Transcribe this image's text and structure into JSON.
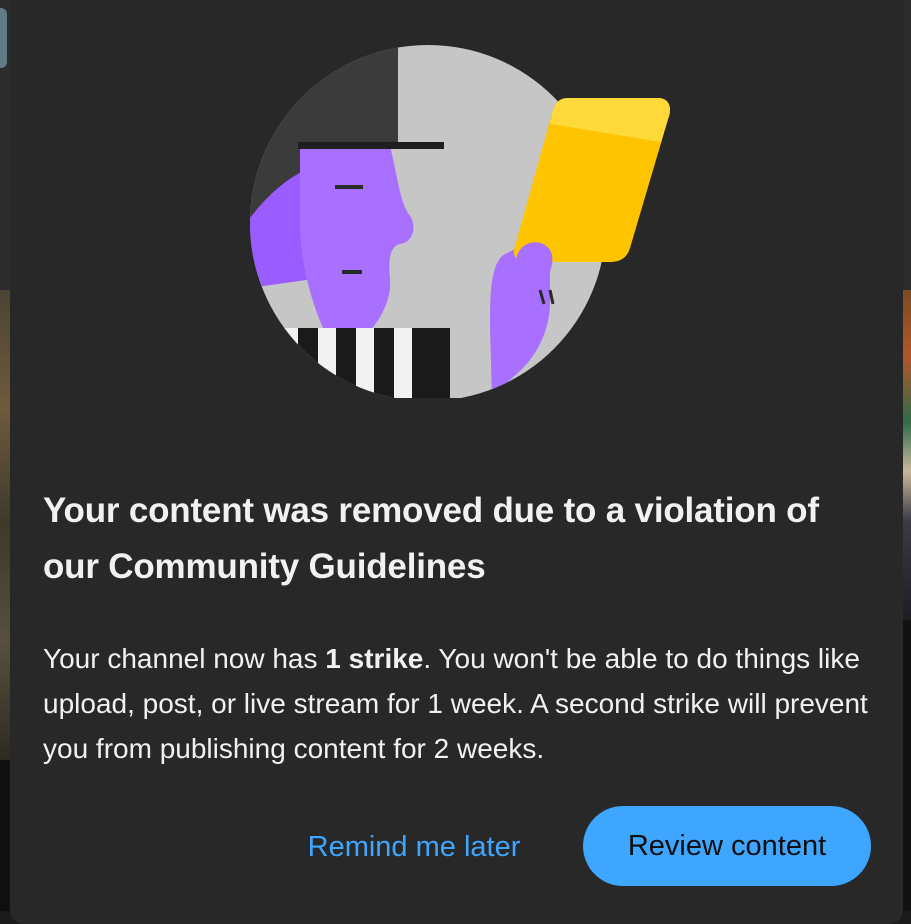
{
  "dialog": {
    "title": "Your content was removed due to a violation of our Community Guidelines",
    "body_before": "Your channel now has ",
    "body_bold": "1 strike",
    "body_after": ". You won't be able to do things like upload, post, or live stream for 1 week. A second strike will prevent you from publishing content for 2 weeks.",
    "illustration_icon": "referee-yellow-card-illustration",
    "buttons": {
      "remind_label": "Remind me later",
      "review_label": "Review content"
    }
  },
  "colors": {
    "dialog_bg": "#282828",
    "accent": "#3ea6ff",
    "text": "#f1f1f1",
    "card_yellow": "#ffc400",
    "figure_purple": "#a970ff"
  }
}
